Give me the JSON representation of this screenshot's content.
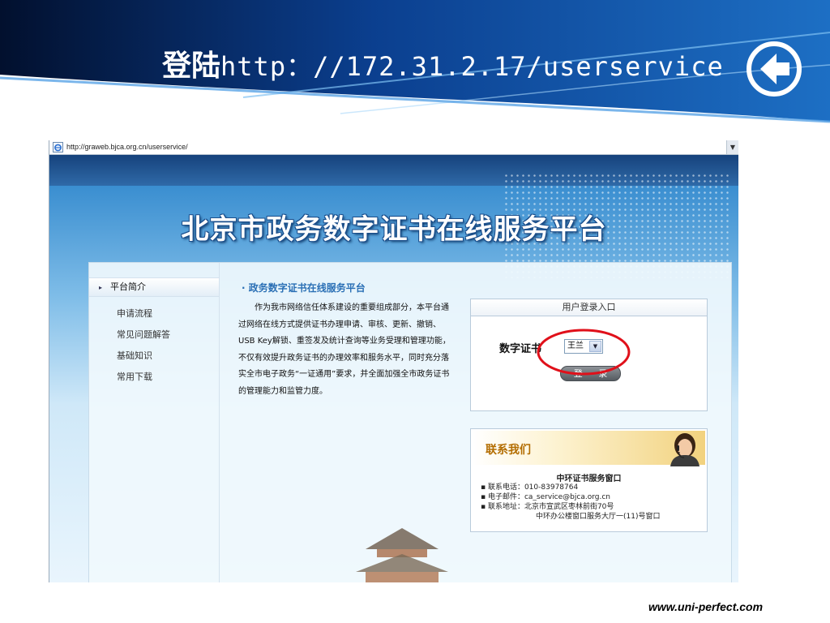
{
  "slide": {
    "title_cn": "登陆",
    "title_url": "http：//172.31.2.17/userservice",
    "back_icon": "arrow-left-circle-icon",
    "footer": "www.uni-perfect.com"
  },
  "browser": {
    "address": "http://graweb.bjca.org.cn/userservice/"
  },
  "portal": {
    "title": "北京市政务数字证书在线服务平台",
    "sidebar": {
      "active": "平台简介",
      "items": [
        "申请流程",
        "常见问题解答",
        "基础知识",
        "常用下载"
      ]
    },
    "section_title": "· 政务数字证书在线服务平台",
    "intro": "作为我市网络信任体系建设的重要组成部分，本平台通过网络在线方式提供证书办理申请、审核、更新、撤销、USB Key解锁、重签发及统计查询等业务受理和管理功能，不仅有效提升政务证书的办理效率和服务水平，同时充分落实全市电子政务“一证通用”要求，并全面加强全市政务证书的管理能力和监管力度。",
    "login": {
      "header": "用户登录入口",
      "cert_label": "数字证书",
      "cert_value": "王兰",
      "button": "登 录"
    },
    "contact": {
      "banner": "联系我们",
      "org": "中环证书服务窗口",
      "phone": "▪ 联系电话：010-83978764",
      "email": "▪ 电子邮件：ca_service@bjca.org.cn",
      "address": "▪ 联系地址：北京市宣武区枣林前街70号",
      "address2": "中环办公楼窗口服务大厅一(11)号窗口"
    }
  },
  "colors": {
    "slide_blue": "#0a3c8c",
    "annotation_red": "#e0101a",
    "link_blue": "#2a6fb5"
  }
}
